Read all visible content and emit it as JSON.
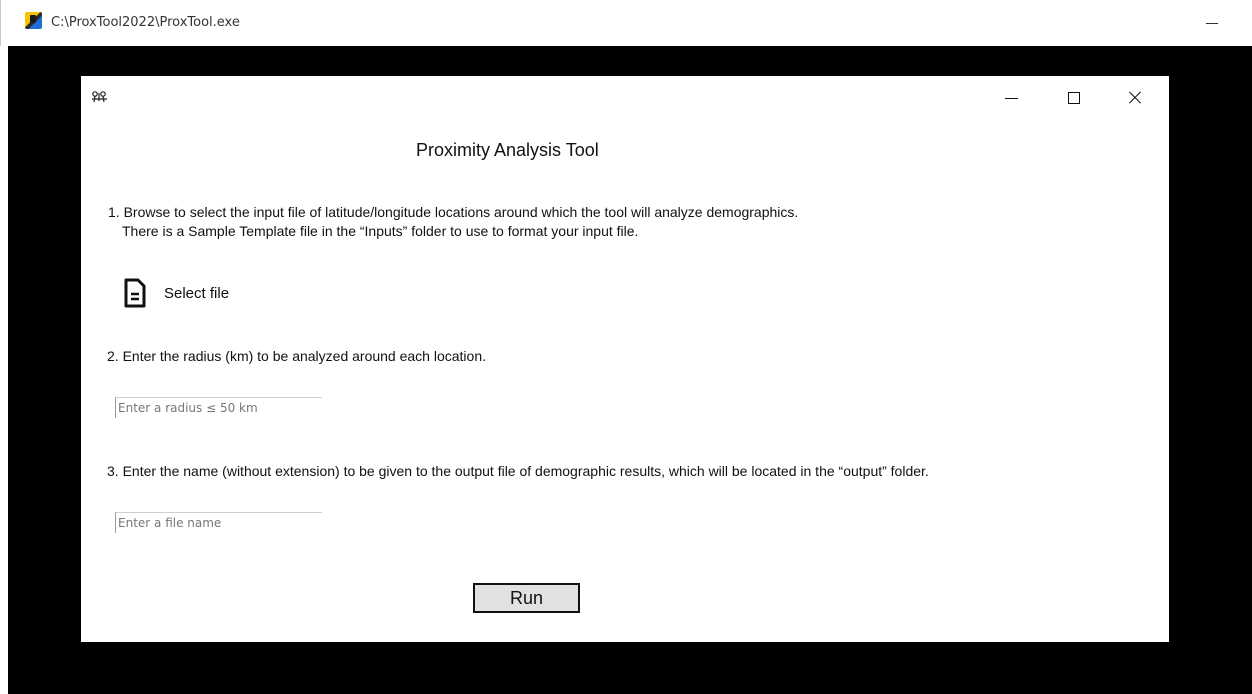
{
  "outer_window": {
    "title": "C:\\ProxTool2022\\ProxTool.exe"
  },
  "app": {
    "title": "Proximity Analysis Tool",
    "step1_line1": "1. Browse to select the input file of latitude/longitude locations around which the tool will analyze demographics.",
    "step1_line2": "There is a Sample Template file in the “Inputs” folder to use to format your input file.",
    "select_file_label": "Select file",
    "step2": "2. Enter the radius (km) to be analyzed around each location.",
    "radius_placeholder": "Enter a radius ≤ 50 km",
    "step3": "3.  Enter the name (without extension) to be given to the output file of demographic results, which will be located in the “output” folder.",
    "filename_placeholder": "Enter a file name",
    "run_label": "Run"
  },
  "icons": {
    "outer_app": "proxtool-app-icon",
    "inner_app": "feather-app-icon",
    "select_file": "document-icon"
  }
}
